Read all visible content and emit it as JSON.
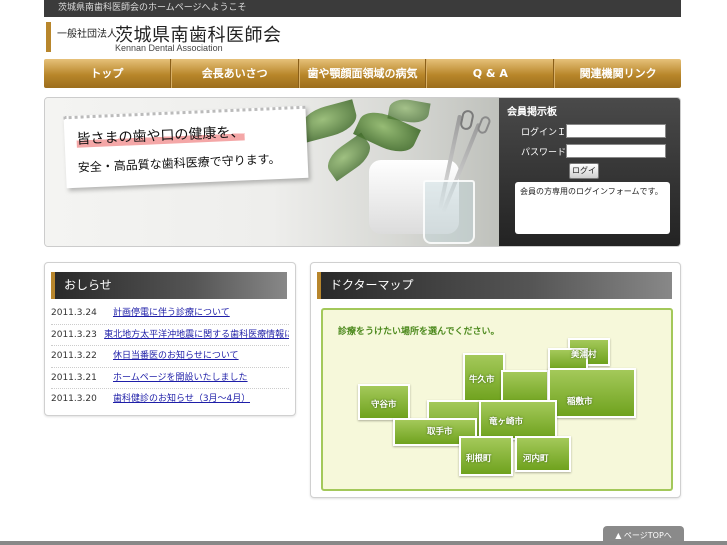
{
  "topbar": {
    "text": "茨城県南歯科医師会のホームページへようこそ"
  },
  "brand": {
    "org_type": "一般社団法人",
    "name": "茨城県南歯科医師会",
    "name_en": "Kennan Dental Association"
  },
  "nav": {
    "items": [
      {
        "label": "トップ"
      },
      {
        "label": "会長あいさつ"
      },
      {
        "label": "歯や顎顔面領域の病気"
      },
      {
        "label": "Q & A"
      },
      {
        "label": "関連機関リンク"
      }
    ]
  },
  "hero": {
    "line1": "皆さまの歯や口の健康を、",
    "line2": "安全・高品質な歯科医療で守ります。"
  },
  "login": {
    "title": "会員掲示板",
    "id_label": "ログインＩＤ",
    "password_label": "パスワード",
    "id_value": "",
    "password_value": "",
    "button_label": "ログイン",
    "note": "会員の方専用のログインフォームです。"
  },
  "news": {
    "title": "おしらせ",
    "items": [
      {
        "date": "2011.3.24",
        "text": "計画停電に伴う診療について"
      },
      {
        "date": "2011.3.23",
        "text": "東北地方太平洋沖地震に関する歯科医療情報について"
      },
      {
        "date": "2011.3.22",
        "text": "休日当番医のお知らせについて"
      },
      {
        "date": "2011.3.21",
        "text": "ホームページを開設いたしました"
      },
      {
        "date": "2011.3.20",
        "text": "歯科健診のお知らせ（3月～4月）"
      }
    ]
  },
  "doctor_map": {
    "title": "ドクターマップ",
    "caption": "診療をうけたい場所を選んでください。",
    "regions": [
      {
        "id": "miho",
        "label": "美浦村"
      },
      {
        "id": "ushiku",
        "label": "牛久市"
      },
      {
        "id": "inashiki",
        "label": "稲敷市"
      },
      {
        "id": "moriya",
        "label": "守谷市"
      },
      {
        "id": "toride",
        "label": "取手市"
      },
      {
        "id": "ryugasaki",
        "label": "竜ヶ崎市"
      },
      {
        "id": "tone",
        "label": "利根町"
      },
      {
        "id": "kawachi",
        "label": "河内町"
      }
    ]
  },
  "footer": {
    "pagetop_label": "ページTOPへ"
  }
}
